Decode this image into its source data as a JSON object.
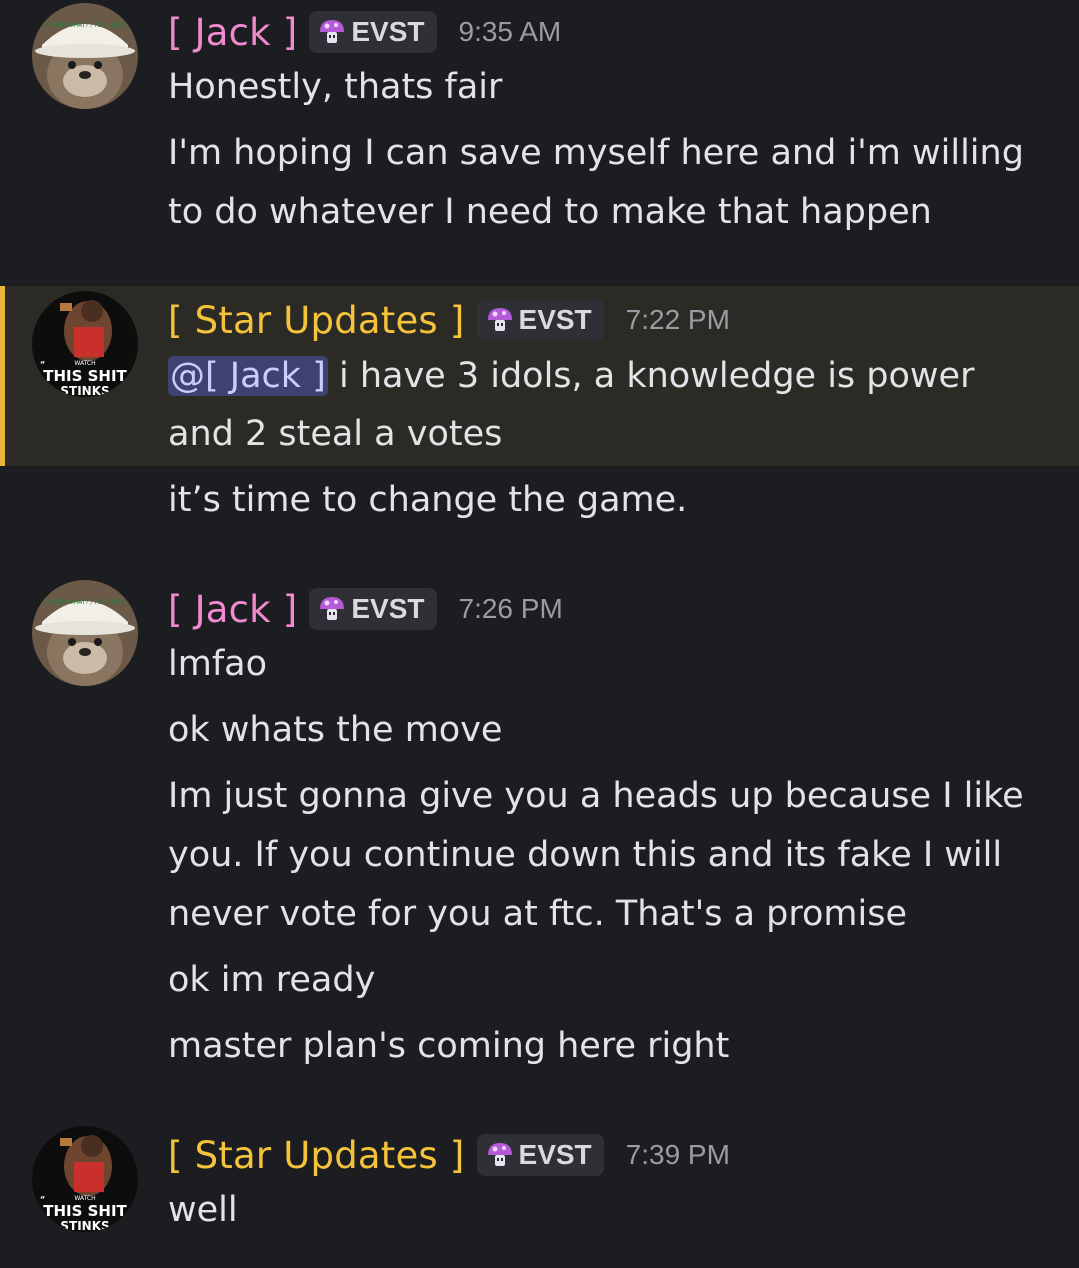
{
  "messages": [
    {
      "user": "[ Jack ]",
      "tag": "EVST",
      "time": "9:35 AM",
      "lines": [
        "Honestly, thats fair",
        "I'm hoping I can save myself here and i'm willing",
        "to do whatever I need to make that happen"
      ]
    },
    {
      "user": "[ Star Updates ]",
      "tag": "EVST",
      "time": "7:22 PM",
      "mention": "@[ Jack ]",
      "lines": [
        " i have 3 idols, a knowledge is power",
        "and 2 steal a votes",
        "it’s time to change the game."
      ]
    },
    {
      "user": "[ Jack ]",
      "tag": "EVST",
      "time": "7:26 PM",
      "lines": [
        "lmfao",
        "ok whats the move",
        "Im just gonna give you a heads up because I like",
        "you. If you continue down this and its fake I will",
        "never vote for you at ftc. That's a promise",
        "ok im ready",
        "master plan's coming here right"
      ]
    },
    {
      "user": "[ Star Updates ]",
      "tag": "EVST",
      "time": "7:39 PM",
      "lines": [
        "well"
      ]
    }
  ],
  "avatars": {
    "jack": {
      "hat_text": "UNDER WHAT? / PBS / KIDS",
      "icon": "otter-avatar"
    },
    "star": {
      "caption_small": "WATCH",
      "caption": "THIS SHIT",
      "caption_end": "STINKS",
      "icon": "basketball-player-avatar"
    }
  },
  "colors": {
    "background": "#1c1d21",
    "jack_name": "#f28ad0",
    "star_name": "#f5c33b",
    "highlight_bar": "#e6b53a",
    "mention_bg": "#3d4270"
  }
}
